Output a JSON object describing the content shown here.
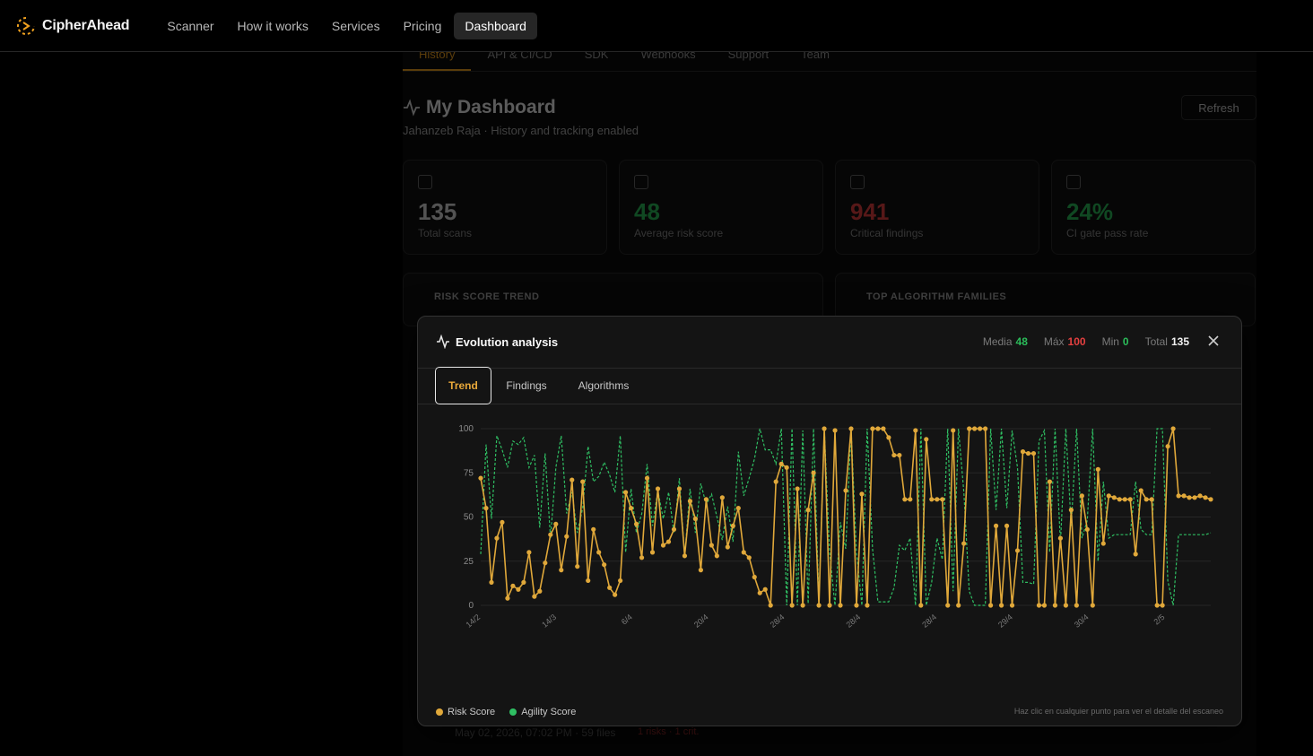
{
  "nav": {
    "brand": "CipherAhead",
    "items": [
      "Scanner",
      "How it works",
      "Services",
      "Pricing",
      "Dashboard"
    ],
    "active": "Dashboard"
  },
  "dashboard": {
    "tabs": [
      "History",
      "API & CI/CD",
      "SDK",
      "Webhooks",
      "Support",
      "Team"
    ],
    "title": "My Dashboard",
    "subtitle": "Jahanzeb Raja · History and tracking enabled",
    "refresh": "Refresh",
    "cards": [
      {
        "value": "135",
        "label": "Total scans",
        "color": "#d9d9d9"
      },
      {
        "value": "48",
        "label": "Average risk score",
        "color": "#2bbd5a"
      },
      {
        "value": "941",
        "label": "Critical findings",
        "color": "#e54040"
      },
      {
        "value": "24%",
        "label": "CI gate pass rate",
        "color": "#2bbd5a"
      }
    ],
    "panel_left": "RISK SCORE TREND",
    "panel_right": "TOP ALGORITHM FAMILIES",
    "bottom_date": "May 02, 2026, 07:02 PM · 59 files",
    "bottom_risk": "1 risks · 1 crit."
  },
  "modal": {
    "title": "Evolution analysis",
    "stats": {
      "media_label": "Media",
      "media_value": "48",
      "max_label": "Máx",
      "max_value": "100",
      "min_label": "Min",
      "min_value": "0",
      "total_label": "Total",
      "total_value": "135"
    },
    "tabs": [
      "Trend",
      "Findings",
      "Algorithms"
    ],
    "active_tab": "Trend",
    "legend": [
      "Risk Score",
      "Agility Score"
    ],
    "hint": "Haz clic en cualquier punto para ver el detalle del escaneo"
  },
  "colors": {
    "risk": "#e0a83a",
    "agility": "#2fbf63",
    "green": "#2bbd5a",
    "red": "#e54040",
    "accent": "#f0a11f"
  },
  "chart_data": {
    "type": "line",
    "ylim": [
      0,
      100
    ],
    "yticks": [
      0,
      25,
      50,
      75,
      100
    ],
    "xticks": [
      "14/2",
      "14/3",
      "6/4",
      "20/4",
      "28/4",
      "28/4",
      "28/4",
      "29/4",
      "30/4",
      "2/5"
    ],
    "series": [
      {
        "name": "Risk Score",
        "values": [
          72,
          55,
          13,
          38,
          47,
          4,
          11,
          9,
          13,
          30,
          5,
          8,
          24,
          40,
          46,
          20,
          39,
          71,
          22,
          70,
          14,
          43,
          30,
          23,
          10,
          6,
          14,
          64,
          55,
          46,
          27,
          72,
          30,
          66,
          34,
          36,
          43,
          66,
          28,
          59,
          49,
          20,
          60,
          34,
          28,
          61,
          33,
          45,
          55,
          30,
          27,
          16,
          7,
          9,
          0,
          70,
          80,
          78,
          0,
          66,
          0,
          54,
          75,
          0,
          100,
          0,
          99,
          0,
          65,
          100,
          0,
          63,
          0,
          100,
          100,
          100,
          95,
          85,
          85,
          60,
          60,
          99,
          0,
          94,
          60,
          60,
          60,
          0,
          99,
          0,
          35,
          100,
          100,
          100,
          100,
          0,
          45,
          0,
          45,
          0,
          31,
          87,
          86,
          86,
          0,
          0,
          70,
          0,
          38,
          0,
          54,
          0,
          62,
          43,
          0,
          77,
          35,
          62,
          61,
          60,
          60,
          60,
          29,
          65,
          60,
          60,
          0,
          0,
          90,
          100,
          62,
          62,
          61,
          61,
          62,
          61,
          60
        ]
      },
      {
        "name": "Agility Score",
        "values": [
          29,
          91,
          49,
          96,
          88,
          78,
          93,
          91,
          95,
          78,
          85,
          44,
          86,
          38,
          78,
          96,
          52,
          64,
          41,
          55,
          90,
          70,
          73,
          81,
          74,
          64,
          96,
          30,
          66,
          41,
          52,
          80,
          45,
          65,
          49,
          64,
          41,
          72,
          28,
          66,
          41,
          69,
          57,
          63,
          50,
          37,
          56,
          36,
          87,
          62,
          72,
          83,
          100,
          88,
          88,
          80,
          100,
          0,
          100,
          0,
          99,
          1,
          100,
          3,
          100,
          30,
          0,
          47,
          32,
          100,
          30,
          0,
          100,
          32,
          2,
          2,
          2,
          10,
          34,
          31,
          38,
          0,
          100,
          0,
          13,
          38,
          26,
          100,
          8,
          100,
          64,
          8,
          0,
          0,
          0,
          100,
          54,
          100,
          55,
          99,
          78,
          13,
          13,
          12,
          93,
          99,
          30,
          100,
          35,
          100,
          45,
          100,
          38,
          48,
          100,
          25,
          70,
          38,
          40,
          40,
          40,
          40,
          70,
          43,
          40,
          40,
          100,
          100,
          14,
          0,
          40,
          40,
          40,
          40,
          40,
          40,
          41
        ]
      }
    ]
  }
}
